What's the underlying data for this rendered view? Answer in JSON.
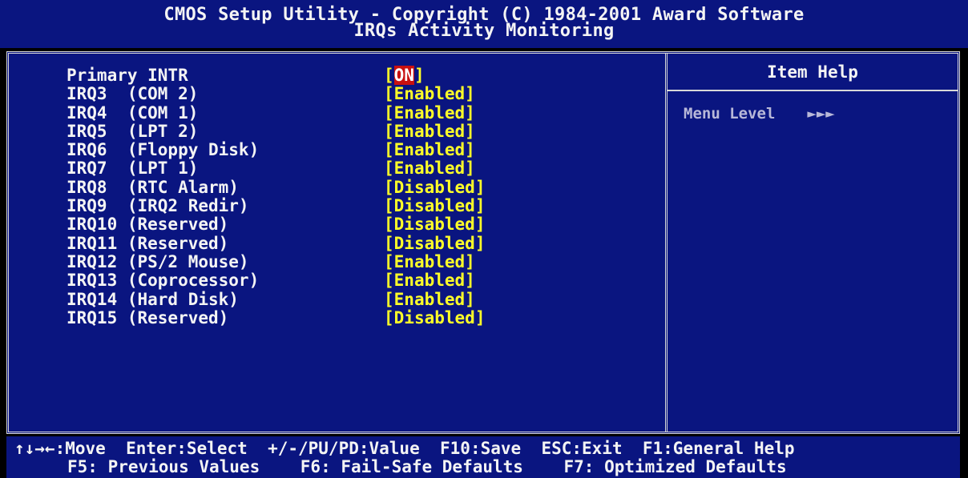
{
  "header": {
    "title": "CMOS Setup Utility - Copyright (C) 1984-2001 Award Software",
    "subtitle": "IRQs Activity Monitoring"
  },
  "settings": [
    {
      "label": "Primary INTR",
      "value": "ON",
      "selected": true
    },
    {
      "label": "IRQ3  (COM 2)",
      "value": "Enabled"
    },
    {
      "label": "IRQ4  (COM 1)",
      "value": "Enabled"
    },
    {
      "label": "IRQ5  (LPT 2)",
      "value": "Enabled"
    },
    {
      "label": "IRQ6  (Floppy Disk)",
      "value": "Enabled"
    },
    {
      "label": "IRQ7  (LPT 1)",
      "value": "Enabled"
    },
    {
      "label": "IRQ8  (RTC Alarm)",
      "value": "Disabled"
    },
    {
      "label": "IRQ9  (IRQ2 Redir)",
      "value": "Disabled"
    },
    {
      "label": "IRQ10 (Reserved)",
      "value": "Disabled"
    },
    {
      "label": "IRQ11 (Reserved)",
      "value": "Disabled"
    },
    {
      "label": "IRQ12 (PS/2 Mouse)",
      "value": "Enabled"
    },
    {
      "label": "IRQ13 (Coprocessor)",
      "value": "Enabled"
    },
    {
      "label": "IRQ14 (Hard Disk)",
      "value": "Enabled"
    },
    {
      "label": "IRQ15 (Reserved)",
      "value": "Disabled"
    }
  ],
  "help": {
    "title": "Item Help",
    "menu_level_label": "Menu Level",
    "menu_level_arrows": "►►►"
  },
  "footer": {
    "line1": "↑↓→←:Move  Enter:Select  +/-/PU/PD:Value  F10:Save  ESC:Exit  F1:General Help",
    "line2": "F5: Previous Values    F6: Fail-Safe Defaults    F7: Optimized Defaults"
  },
  "colors": {
    "background": "#0a1580",
    "text": "#f4f4f4",
    "value": "#ffff28",
    "highlight": "#c81010"
  }
}
